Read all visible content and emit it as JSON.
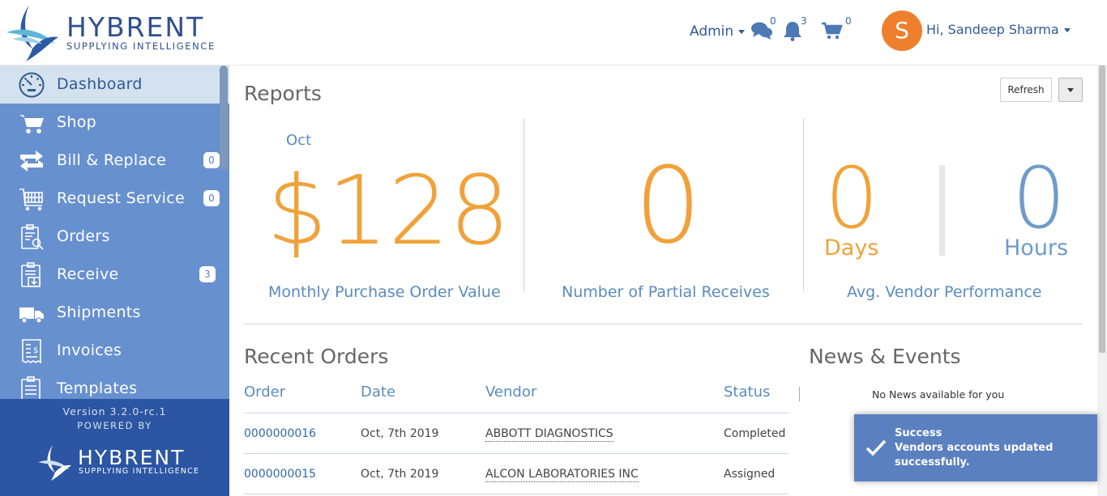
{
  "header": {
    "brand": "HYBRENT",
    "tagline": "SUPPLYING INTELLIGENCE",
    "admin_label": "Admin",
    "messages_count": "0",
    "notifications_count": "3",
    "cart_count": "0",
    "avatar_initial": "S",
    "greeting": "Hi, Sandeep Sharma"
  },
  "sidebar": {
    "items": [
      {
        "label": "Dashboard",
        "icon": "dashboard-gauge-icon",
        "badge": ""
      },
      {
        "label": "Shop",
        "icon": "shopping-cart-icon",
        "badge": ""
      },
      {
        "label": "Bill & Replace",
        "icon": "swap-arrows-icon",
        "badge": "0"
      },
      {
        "label": "Request Service",
        "icon": "service-cart-icon",
        "badge": "0"
      },
      {
        "label": "Orders",
        "icon": "clipboard-search-icon",
        "badge": ""
      },
      {
        "label": "Receive",
        "icon": "clipboard-download-icon",
        "badge": "3"
      },
      {
        "label": "Shipments",
        "icon": "truck-icon",
        "badge": ""
      },
      {
        "label": "Invoices",
        "icon": "invoice-icon",
        "badge": ""
      },
      {
        "label": "Templates",
        "icon": "clipboard-list-icon",
        "badge": ""
      }
    ],
    "version": "Version 3.2.0-rc.1",
    "powered_by": "POWERED BY",
    "footer_brand": "HYBRENT",
    "footer_tagline": "SUPPLYING INTELLIGENCE"
  },
  "reports": {
    "title": "Reports",
    "refresh_label": "Refresh",
    "month": "Oct",
    "po_value": "$128",
    "po_label": "Monthly Purchase Order Value",
    "partial_value": "0",
    "partial_label": "Number of Partial Receives",
    "days_value": "0",
    "days_unit": "Days",
    "hours_value": "0",
    "hours_unit": "Hours",
    "vendor_perf_label": "Avg. Vendor Performance"
  },
  "recent_orders": {
    "title": "Recent Orders",
    "columns": [
      "Order",
      "Date",
      "Vendor",
      "Status"
    ],
    "rows": [
      {
        "order": "0000000016",
        "date": "Oct, 7th 2019",
        "vendor": "ABBOTT DIAGNOSTICS",
        "status": "Completed"
      },
      {
        "order": "0000000015",
        "date": "Oct, 7th 2019",
        "vendor": "ALCON LABORATORIES INC",
        "status": "Assigned"
      }
    ]
  },
  "news": {
    "title": "News & Events",
    "empty_text": "No News available for you"
  },
  "toast": {
    "title": "Success",
    "message": "Vendors accounts updated successfully."
  },
  "colors": {
    "accent_orange": "#f0a23a",
    "accent_blue": "#5b8bbf",
    "sidebar_bg": "#6790cf",
    "sidebar_footer": "#2c55a3",
    "toast_bg": "#5a80c0"
  }
}
